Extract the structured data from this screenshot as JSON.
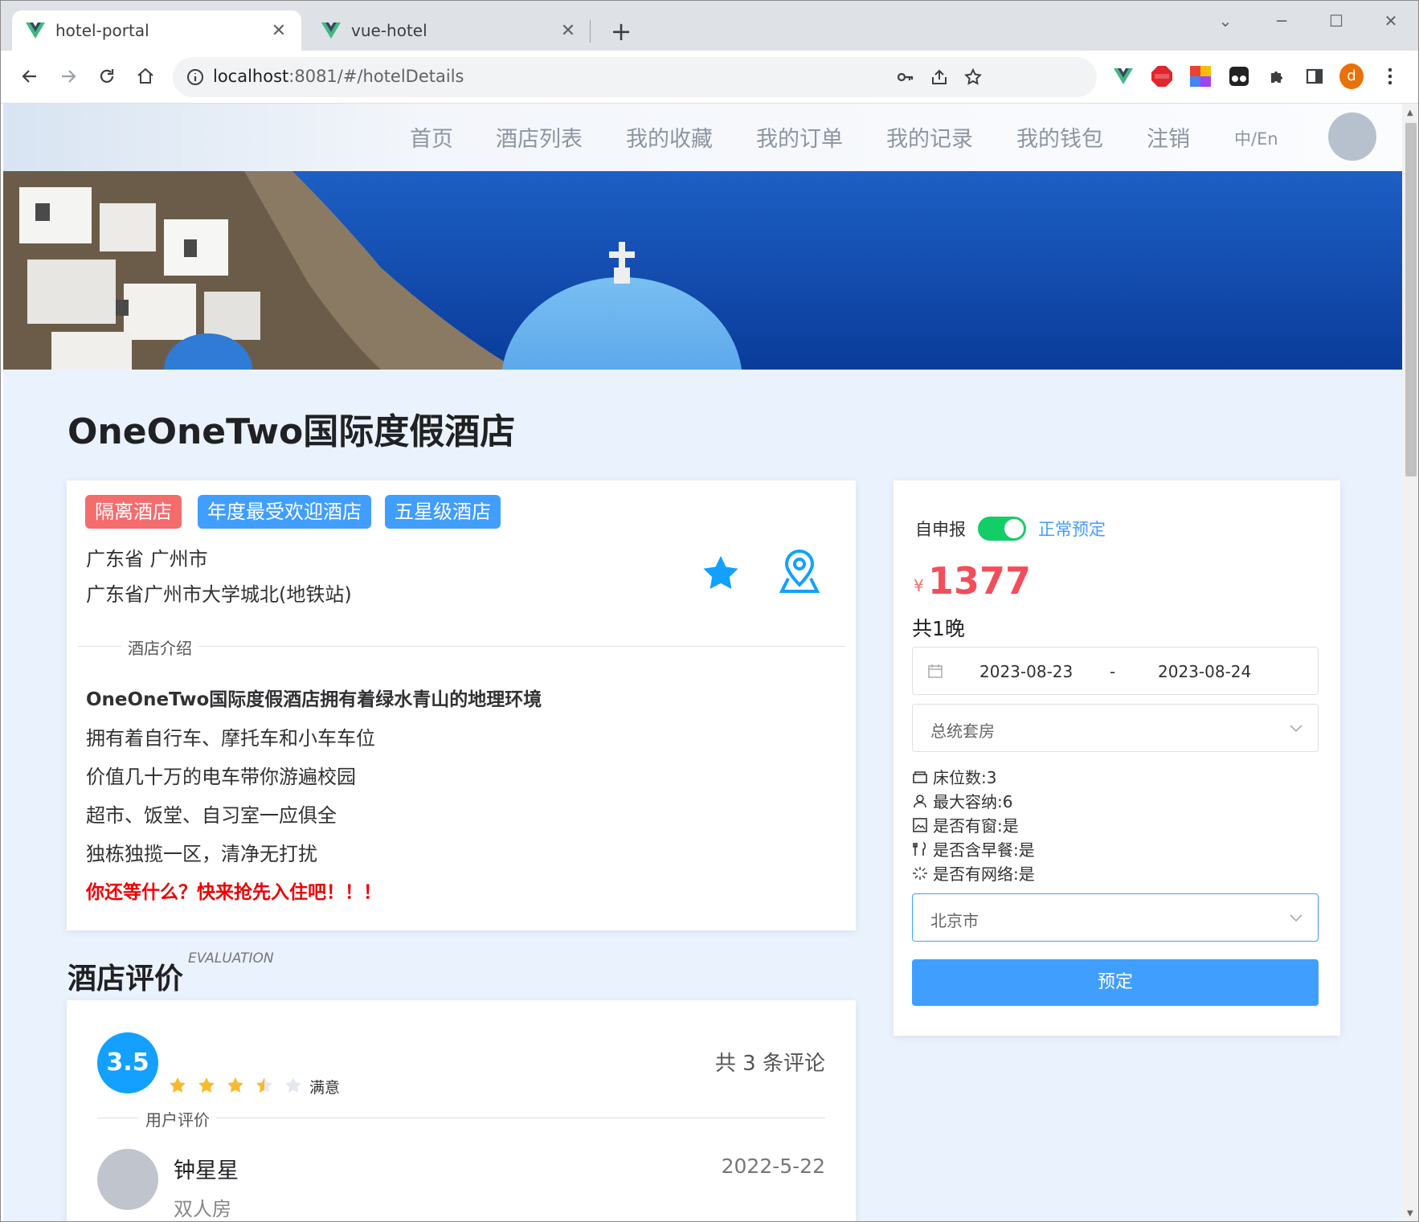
{
  "browser": {
    "tabs": [
      {
        "title": "hotel-portal",
        "active": true
      },
      {
        "title": "vue-hotel",
        "active": false
      }
    ],
    "url_host": "localhost",
    "url_rest": ":8081/#/hotelDetails",
    "profile_initial": "d"
  },
  "nav": {
    "items": [
      "首页",
      "酒店列表",
      "我的收藏",
      "我的订单",
      "我的记录",
      "我的钱包",
      "注销"
    ],
    "lang": "中/En"
  },
  "hotel": {
    "name": "OneOneTwo国际度假酒店",
    "tags": [
      {
        "label": "隔离酒店",
        "color": "#f56c6c"
      },
      {
        "label": "年度最受欢迎酒店",
        "color": "#409eff"
      },
      {
        "label": "五星级酒店",
        "color": "#409eff"
      }
    ],
    "region": "广东省 广州市",
    "address": "广东省广州市大学城北(地铁站)",
    "intro_title": "酒店介绍",
    "intro_headline": "OneOneTwo国际度假酒店拥有着绿水青山的地理环境",
    "intro_lines": [
      "拥有着自行车、摩托车和小车车位",
      "价值几十万的电车带你游遍校园",
      "超市、饭堂、自习室一应俱全",
      "独栋独揽一区，清净无打扰"
    ],
    "intro_cta": "你还等什么？快来抢先入住吧！！！"
  },
  "booking": {
    "self_report_label": "自申报",
    "toggle_on": true,
    "mode_label": "正常预定",
    "currency": "¥",
    "price": "1377",
    "nights": "共1晚",
    "date_start": "2023-08-23",
    "date_sep": "-",
    "date_end": "2023-08-24",
    "room_type": "总统套房",
    "features": [
      "床位数:3",
      "最大容纳:6",
      "是否有窗:是",
      "是否含早餐:是",
      "是否有网络:是"
    ],
    "city": "北京市",
    "book_button": "预定"
  },
  "reviews": {
    "title": "酒店评价",
    "subtitle": "EVALUATION",
    "score": "3.5",
    "rating": 3.5,
    "rating_text": "满意",
    "total": "共 3 条评论",
    "section_title": "用户评价",
    "items": [
      {
        "user": "钟星星",
        "date": "2022-5-22",
        "room": "双人房"
      }
    ]
  }
}
